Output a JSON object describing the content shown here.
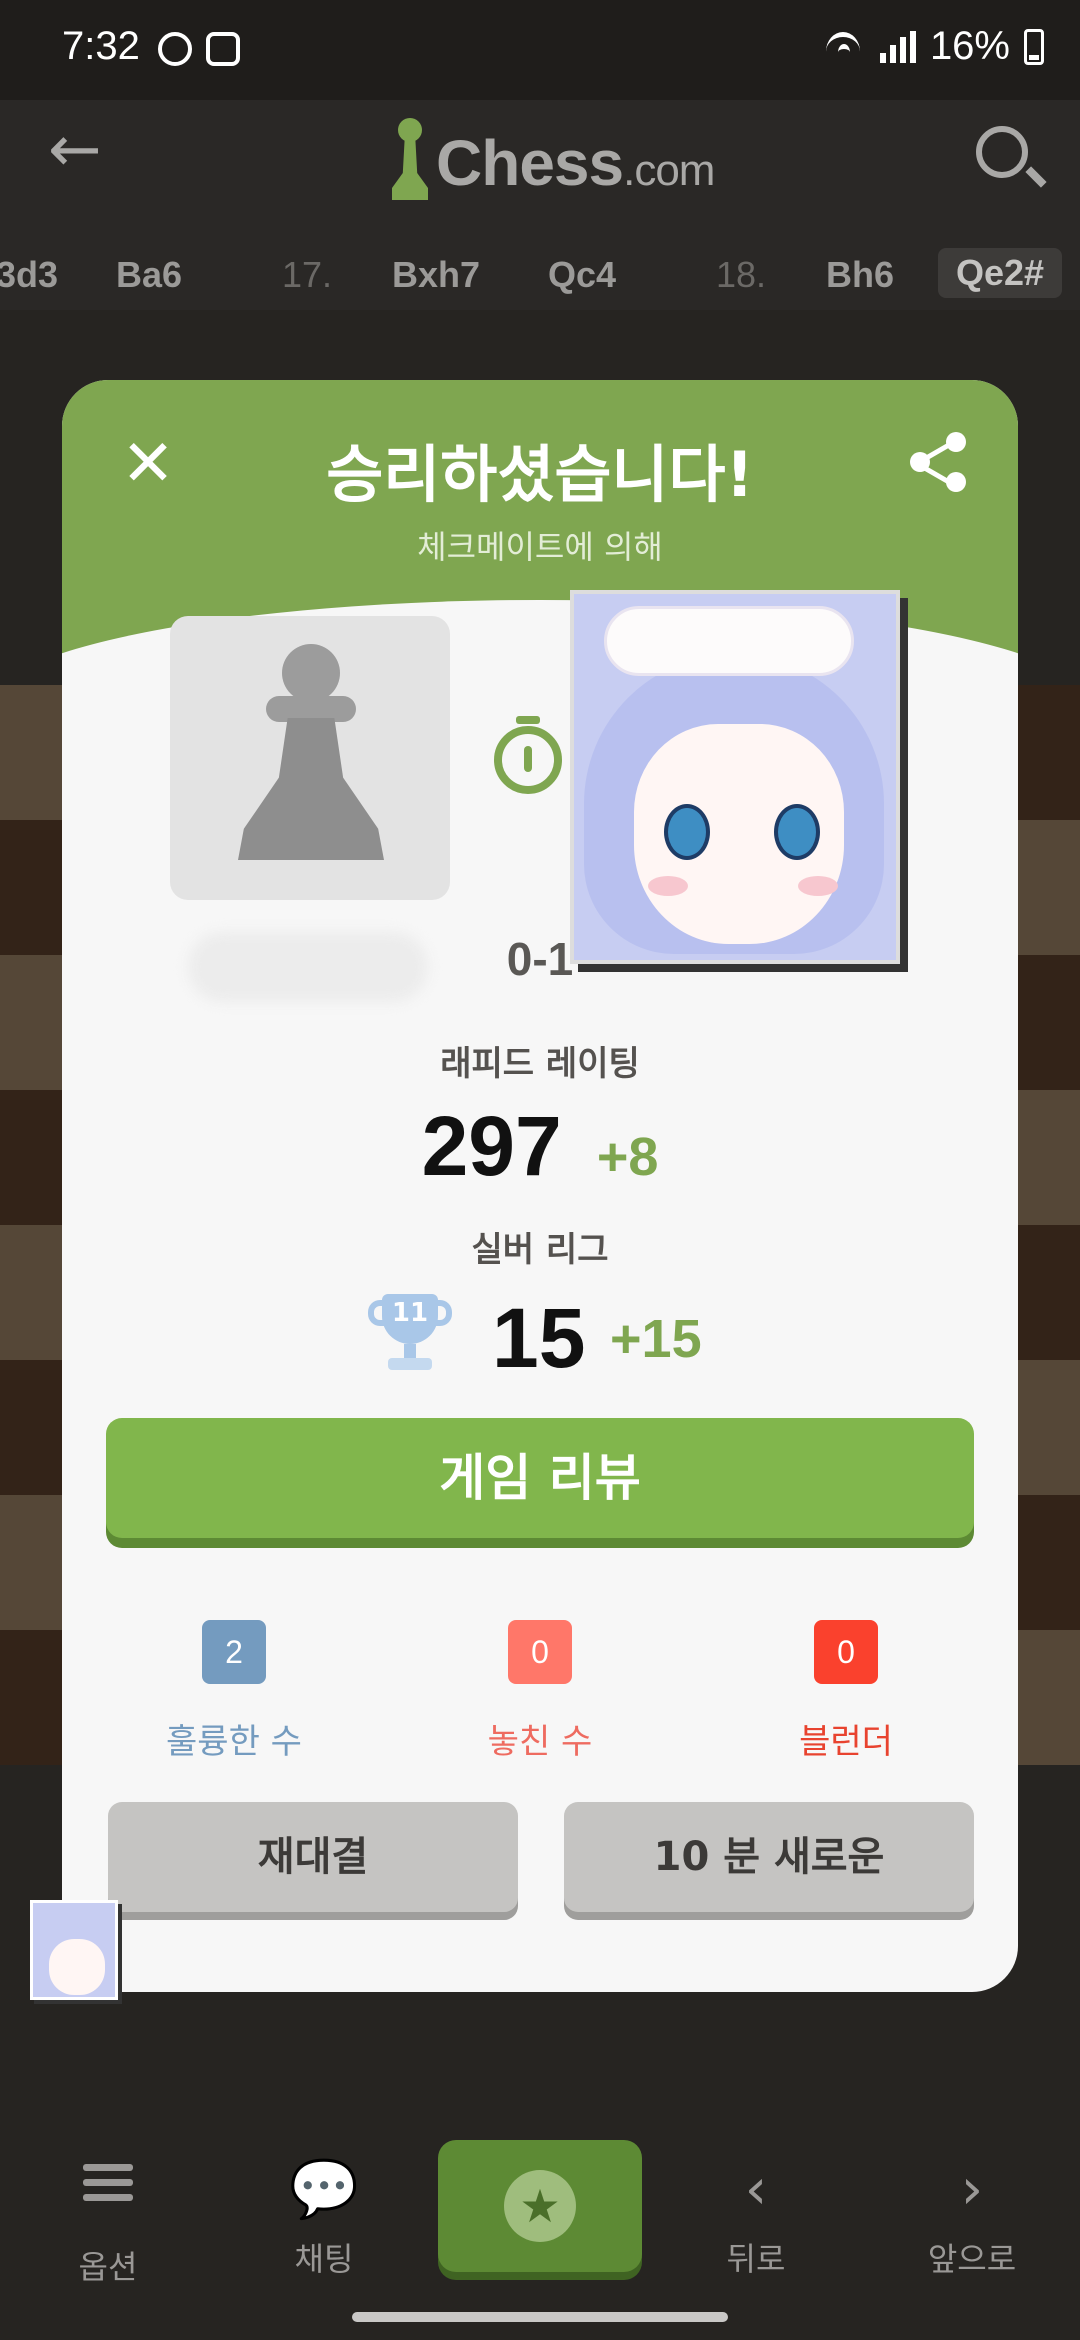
{
  "status_bar": {
    "time": "7:32",
    "battery": "16%"
  },
  "header": {
    "logo_main": "Chess",
    "logo_suffix": ".com"
  },
  "moves": [
    {
      "text": "3d3",
      "kind": "move"
    },
    {
      "text": "Ba6",
      "kind": "move"
    },
    {
      "text": "17.",
      "kind": "num"
    },
    {
      "text": "Bxh7",
      "kind": "move"
    },
    {
      "text": "Qc4",
      "kind": "move"
    },
    {
      "text": "18.",
      "kind": "num"
    },
    {
      "text": "Bh6",
      "kind": "move"
    },
    {
      "text": "Qe2#",
      "kind": "last"
    }
  ],
  "modal": {
    "title": "승리하셨습니다!",
    "subtitle": "체크메이트에 의해",
    "score": "0-1",
    "rating_label": "래피드 레이팅",
    "rating_value": "297",
    "rating_delta": "+8",
    "league_label": "실버 리그",
    "league_trophy_number": "11",
    "league_value": "15",
    "league_delta": "+15",
    "review_button": "게임 리뷰",
    "stats": [
      {
        "count": "2",
        "label": "훌륭한 수",
        "color": "#749bbf",
        "label_color": "#749bbf"
      },
      {
        "count": "0",
        "label": "놓친 수",
        "color": "#ff7769",
        "label_color": "#ee6b60"
      },
      {
        "count": "0",
        "label": "블런더",
        "color": "#fa412d",
        "label_color": "#e8432f"
      }
    ],
    "rematch_button": "재대결",
    "new_game_button": "10 분 새로운"
  },
  "bottom_nav": {
    "options": "옵션",
    "chat": "채팅",
    "back": "뒤로",
    "forward": "앞으로"
  },
  "colors": {
    "accent_green": "#81b64c",
    "header_green": "#7fa650"
  }
}
